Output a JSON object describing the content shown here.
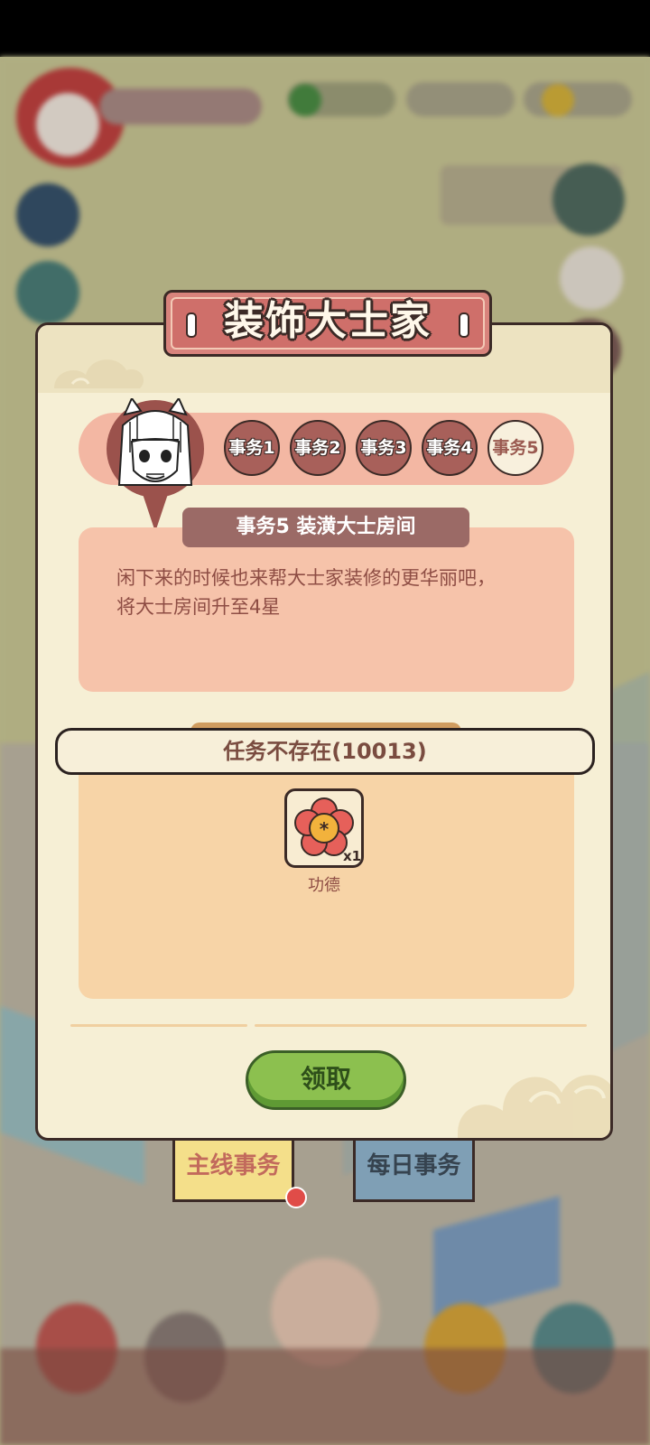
{
  "dialog": {
    "title": "装饰大士家",
    "tasks": [
      "事务1",
      "事务2",
      "事务3",
      "事务4",
      "事务5"
    ],
    "active_task_index": 4,
    "subtitle": "事务5  装潢大士房间",
    "description": "闲下来的时候也来帮大士家装修的更华丽吧，将大士房间升至4星",
    "toast": "任务不存在(10013)",
    "reward": {
      "name": "功德",
      "count": "x1",
      "icon": "plum-blossom-icon"
    },
    "claim_label": "领取"
  },
  "tabs": {
    "main_label": "主线事务",
    "daily_label": "每日事务"
  },
  "colors": {
    "accent_red": "#cf6f6a",
    "claim_green": "#8cc04f",
    "panel_bg": "#f6efd5"
  }
}
